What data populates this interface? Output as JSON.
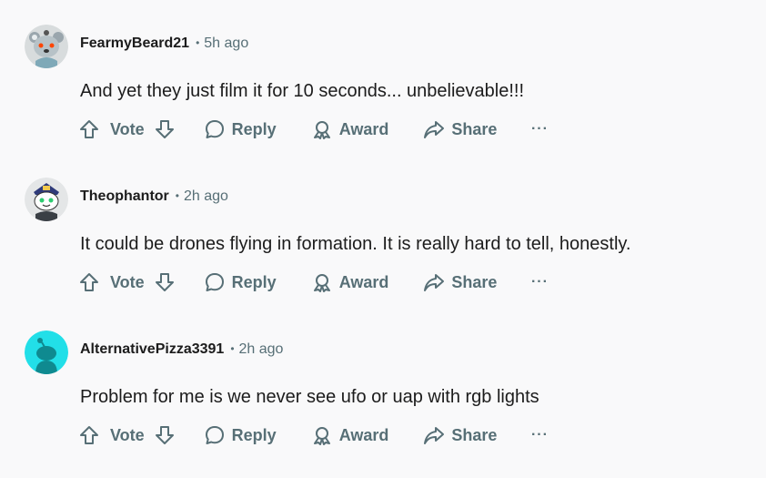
{
  "comments": [
    {
      "username": "FearmyBeard21",
      "separator": "•",
      "time": "5h ago",
      "text": "And yet they just film it for 10 seconds... unbelievable!!!",
      "avatar": {
        "icon": "snoo-avatar-koala-icon",
        "bg": "#d8dcdd"
      }
    },
    {
      "username": "Theophantor",
      "separator": "•",
      "time": "2h ago",
      "text": "It could be drones flying in formation. It is really hard to tell, honestly.",
      "avatar": {
        "icon": "snoo-avatar-captain-icon",
        "bg": "#e4e6e7"
      }
    },
    {
      "username": "AlternativePizza3391",
      "separator": "•",
      "time": "2h ago",
      "text": "Problem for me is we never see ufo or uap with rgb lights",
      "avatar": {
        "icon": "snoo-default-avatar-icon",
        "bg": "#22dfe8"
      }
    }
  ],
  "actions": {
    "vote_label": "Vote",
    "reply_label": "Reply",
    "award_label": "Award",
    "share_label": "Share",
    "more_label": "···"
  },
  "colors": {
    "background": "#f9f9fa",
    "meta_text": "#576f76",
    "text": "#1c1c1c"
  }
}
